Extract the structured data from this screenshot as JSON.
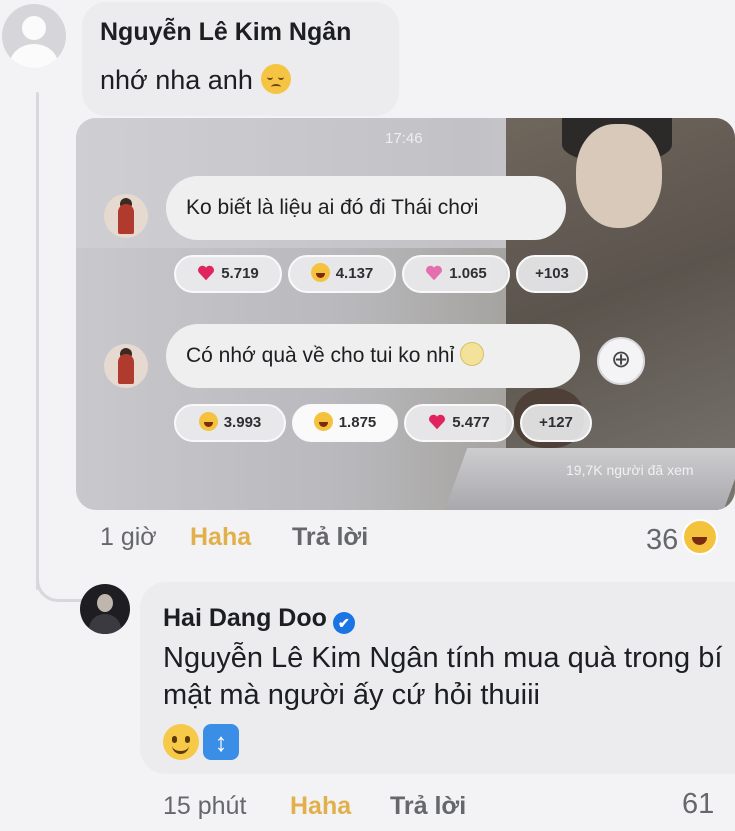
{
  "comment": {
    "author": "Nguyễn Lê Kim Ngân",
    "text": "nhớ nha anh",
    "emoji": "pensive-face",
    "time": "1 giờ",
    "reaction_label": "Haha",
    "reply_label": "Trả lời",
    "reaction_count": "36"
  },
  "attachment": {
    "clock": "17:46",
    "messages": [
      {
        "text": "Ko biết là liệu ai đó đi Thái chơi",
        "reactions": [
          {
            "icon": "heart-icon",
            "value": "5.719"
          },
          {
            "icon": "laugh-icon",
            "value": "4.137"
          },
          {
            "icon": "pink-heart-icon",
            "value": "1.065"
          },
          {
            "icon": "",
            "value": "+103"
          }
        ]
      },
      {
        "text": "Có nhớ quà về cho tui ko nhỉ",
        "reactions": [
          {
            "icon": "laugh-icon",
            "value": "3.993"
          },
          {
            "icon": "laugh-icon",
            "value": "1.875"
          },
          {
            "icon": "heart-icon",
            "value": "5.477"
          },
          {
            "icon": "",
            "value": "+127"
          }
        ]
      }
    ],
    "views": "19,7K người đã xem"
  },
  "reply": {
    "author": "Hai Dang Doo",
    "verified": "✔",
    "text": "Nguyễn Lê Kim Ngân tính mua quà trong bí mật mà người ấy cứ hỏi thuiii",
    "updown_glyph": "↕",
    "time": "15 phút",
    "reaction_label": "Haha",
    "reply_label": "Trả lời",
    "reaction_count": "61"
  },
  "colors": {
    "haha": "#e2b04a",
    "muted": "#65676b",
    "bubble": "#ececee",
    "verified": "#1b74e4"
  }
}
